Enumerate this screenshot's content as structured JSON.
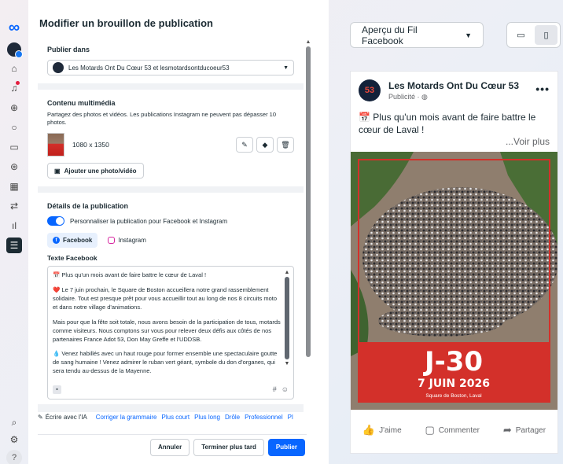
{
  "rail": {
    "logo": "∞",
    "items": [
      "home-icon",
      "notifications-icon",
      "publish-icon",
      "inbox-icon",
      "content-icon",
      "ads-icon",
      "planner-icon",
      "campaign-icon",
      "insights-icon",
      "menu-icon"
    ],
    "bottom": [
      "search-icon",
      "settings-icon",
      "help-icon"
    ],
    "help_label": "?"
  },
  "editor": {
    "title": "Modifier un brouillon de publication",
    "publish_in": {
      "heading": "Publier dans",
      "accounts": "Les Motards Ont Du Cœur 53 et lesmotardsontducoeur53"
    },
    "media": {
      "heading": "Contenu multimédia",
      "description": "Partagez des photos et vidéos. Les publications Instagram ne peuvent pas dépasser 10 photos.",
      "dimensions": "1080 x 1350",
      "add_button": "Ajouter une photo/vidéo"
    },
    "details": {
      "heading": "Détails de la publication",
      "toggle_label": "Personnaliser la publication pour Facebook et Instagram",
      "tabs": [
        "Facebook",
        "Instagram"
      ],
      "text_label": "Texte Facebook",
      "text_paragraphs": [
        "📅 Plus qu'un mois avant de faire battre le cœur de Laval !",
        "❤️ Le 7 juin prochain, le Square de Boston accueillera notre grand rassemblement solidaire. Tout est presque prêt pour vous accueillir tout au long de nos 8 circuits moto et dans notre village d'animations.",
        "Mais pour que la fête soit totale, nous avons besoin de la participation de tous, motards comme visiteurs. Nous comptons sur vous pour relever deux défis aux côtés de nos partenaires France Adot 53, Don May Greffe et l'UDDSB.",
        "💧 Venez habillés avec un haut rouge pour former ensemble une spectaculaire goutte de sang humaine ! Venez admirer le ruban vert géant, symbole du don d'organes, qui sera tendu au-dessus de la Mayenne."
      ],
      "hash": "#",
      "emoji": "☺"
    },
    "ai": {
      "label": "Écrire avec l'IA",
      "links": [
        "Corriger la grammaire",
        "Plus court",
        "Plus long",
        "Drôle",
        "Professionnel",
        "Pl"
      ]
    },
    "buttons": {
      "cancel": "Annuler",
      "later": "Terminer plus tard",
      "publish": "Publier"
    }
  },
  "preview": {
    "dropdown_label": "Aperçu du Fil Facebook",
    "page_name": "Les Motards Ont Du Cœur 53",
    "logo_text": "53",
    "sponsored": "Publicité · ◍",
    "message": "📅 Plus qu'un mois avant de faire battre le cœur de Laval !",
    "see_more": "...Voir plus",
    "image": {
      "countdown": "J-30",
      "date": "7 JUIN 2026",
      "location": "Square de Boston, Laval"
    },
    "actions": [
      "J'aime",
      "Commenter",
      "Partager"
    ]
  },
  "colors": {
    "accent": "#0866ff",
    "poster_red": "#d3302a"
  }
}
